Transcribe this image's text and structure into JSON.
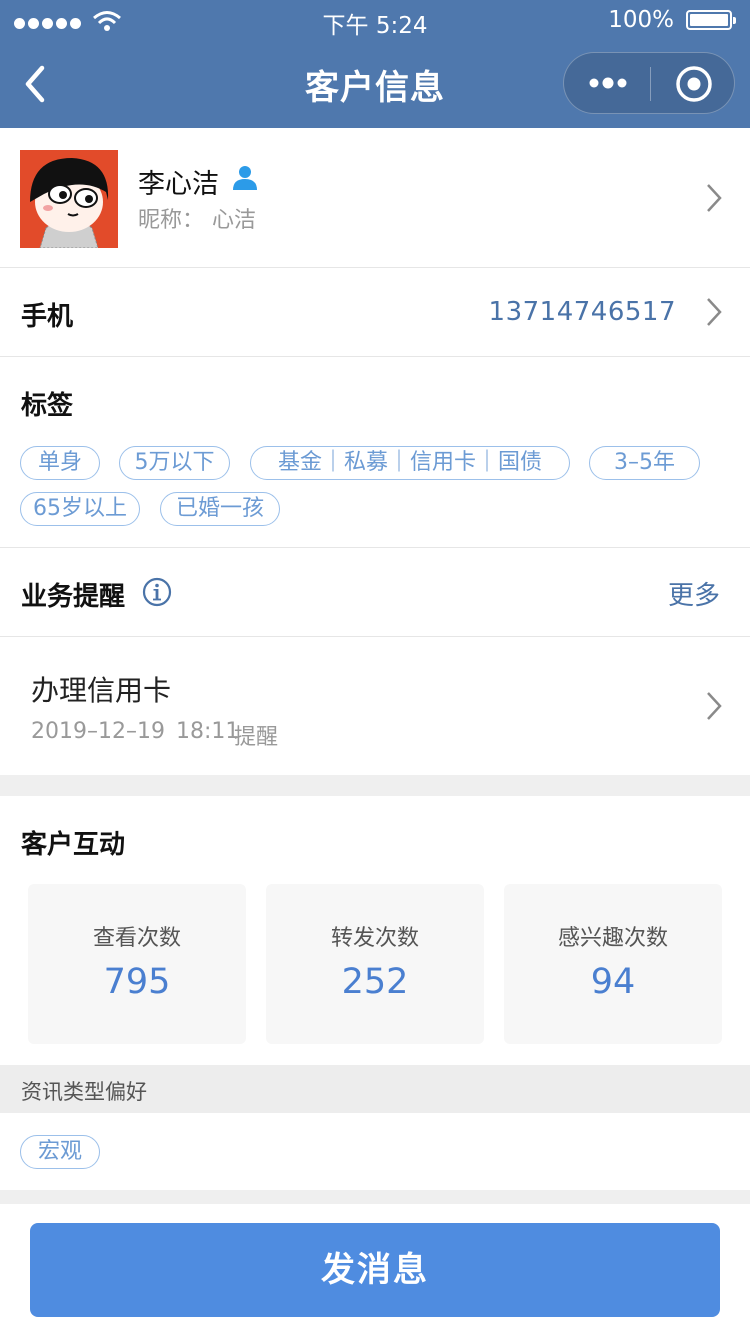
{
  "status_bar": {
    "time": "下午 5:24",
    "battery": "100%"
  },
  "nav": {
    "title": "客户信息"
  },
  "profile": {
    "name": "李心洁",
    "nickname_label": "昵称：",
    "nickname": "心洁"
  },
  "phone": {
    "label": "手机",
    "value": "13714746517"
  },
  "tags": {
    "title": "标签",
    "items": [
      "单身",
      "5万以下",
      "基金｜私募｜信用卡｜国债",
      "3–5年",
      "65岁以上",
      "已婚一孩"
    ]
  },
  "reminder": {
    "title": "业务提醒",
    "more": "更多",
    "task": {
      "title": "办理信用卡",
      "date": "2019–12–19",
      "time": "18:11",
      "remind": "提醒"
    }
  },
  "interaction": {
    "title": "客户互动",
    "stats": [
      {
        "label": "查看次数",
        "value": "795"
      },
      {
        "label": "转发次数",
        "value": "252"
      },
      {
        "label": "感兴趣次数",
        "value": "94"
      }
    ]
  },
  "preference": {
    "title": "资讯类型偏好",
    "tags": [
      "宏观"
    ]
  },
  "action": {
    "send_label": "发消息"
  },
  "colors": {
    "nav_bg": "#4f78ad",
    "accent_blue": "#4a73a8",
    "button_blue": "#4f8ce0",
    "tag_blue": "#6c9bd4"
  }
}
